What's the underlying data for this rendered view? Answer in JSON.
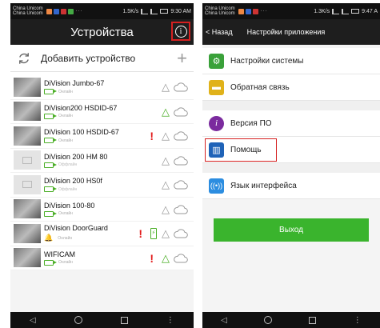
{
  "left": {
    "status": {
      "carrier1": "China Unicom",
      "carrier2": "China Unicom",
      "net_speed": "1.5K/s",
      "time": "9:30 AM"
    },
    "appbar": {
      "title": "Устройства"
    },
    "add_device_label": "Добавить устройство",
    "devices": [
      {
        "name": "DiVision Jumbo-67",
        "status": "Онлайн",
        "bell_color": "grey",
        "warning": false,
        "battery": false
      },
      {
        "name": "DiVision200 HSDID-67",
        "status": "Онлайн",
        "bell_color": "green",
        "warning": false,
        "battery": false
      },
      {
        "name": "DiVision 100 HSDID-67",
        "status": "Онлайн",
        "bell_color": "grey",
        "warning": true,
        "battery": false
      },
      {
        "name": "DiVision 200 HM 80",
        "status": "Оффлайн",
        "bell_color": "grey",
        "warning": false,
        "battery": false
      },
      {
        "name": "DiVision 200 HS0f",
        "status": "Оффлайн",
        "bell_color": "grey",
        "warning": false,
        "battery": false
      },
      {
        "name": "DiVision 100-80",
        "status": "Онлайн",
        "bell_color": "grey",
        "warning": false,
        "battery": false
      },
      {
        "name": "DiVision DoorGuard",
        "status": "Онлайн",
        "bell_color": "grey",
        "warning": true,
        "battery": true
      },
      {
        "name": "WIFICAM",
        "status": "Онлайн",
        "bell_color": "green",
        "warning": true,
        "battery": false
      }
    ]
  },
  "right": {
    "status": {
      "carrier1": "China Unicom",
      "carrier2": "China Unicom",
      "net_speed": "1.3K/s",
      "time": "9:47 A"
    },
    "appbar": {
      "back_label": "Назад",
      "title": "Настройки приложения"
    },
    "group1": [
      {
        "label": "Настройки системы",
        "icon": "gear-icon",
        "color": "#3aa13a"
      },
      {
        "label": "Обратная связь",
        "icon": "chat-icon",
        "color": "#e0b21a"
      }
    ],
    "group2": [
      {
        "label": "Версия ПО",
        "icon": "info-icon",
        "color": "#7b2b9e"
      },
      {
        "label": "Помощь",
        "icon": "book-icon",
        "color": "#1f63b8"
      }
    ],
    "group3": [
      {
        "label": "Язык интерфейса",
        "icon": "broadcast-icon",
        "color": "#2c8de0"
      }
    ],
    "exit_label": "Выход"
  },
  "colors": {
    "accent_green": "#3ab42d",
    "highlight_red": "#d52020",
    "warning_red": "#e21b1b"
  }
}
